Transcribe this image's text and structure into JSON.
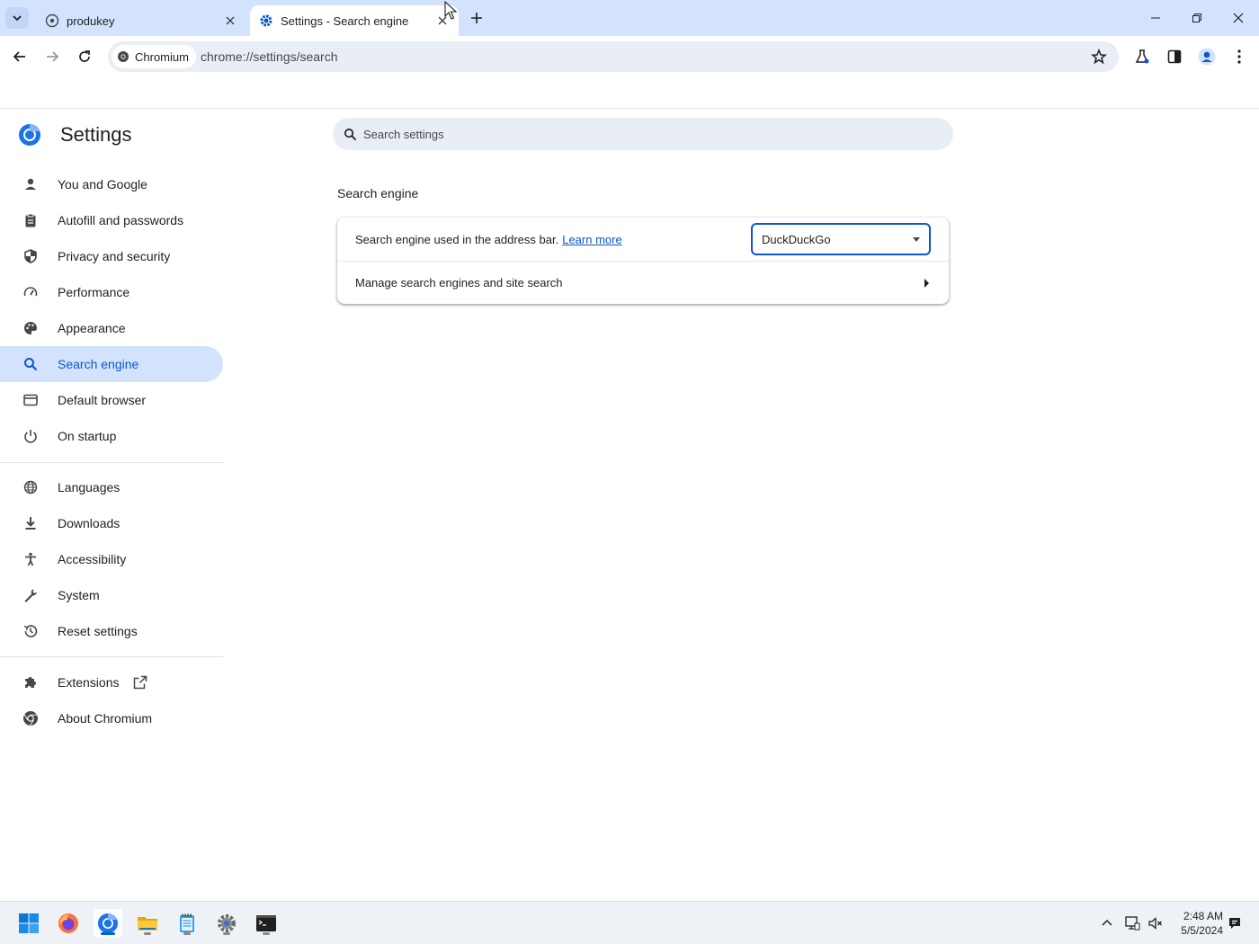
{
  "tabs": [
    {
      "title": "produkey",
      "active": false
    },
    {
      "title": "Settings - Search engine",
      "active": true
    }
  ],
  "toolbar": {
    "site_chip": "Chromium",
    "url": "chrome://settings/search"
  },
  "sidebar": {
    "title": "Settings",
    "items": [
      {
        "label": "You and Google",
        "icon": "person-icon"
      },
      {
        "label": "Autofill and passwords",
        "icon": "clipboard-icon"
      },
      {
        "label": "Privacy and security",
        "icon": "shield-icon"
      },
      {
        "label": "Performance",
        "icon": "speedometer-icon"
      },
      {
        "label": "Appearance",
        "icon": "palette-icon"
      },
      {
        "label": "Search engine",
        "icon": "search-icon",
        "selected": true
      },
      {
        "label": "Default browser",
        "icon": "browser-window-icon"
      },
      {
        "label": "On startup",
        "icon": "power-icon"
      },
      {
        "label": "Languages",
        "icon": "globe-icon"
      },
      {
        "label": "Downloads",
        "icon": "download-icon"
      },
      {
        "label": "Accessibility",
        "icon": "accessibility-icon"
      },
      {
        "label": "System",
        "icon": "wrench-icon"
      },
      {
        "label": "Reset settings",
        "icon": "history-icon"
      },
      {
        "label": "Extensions",
        "icon": "puzzle-icon"
      },
      {
        "label": "About Chromium",
        "icon": "chromium-icon"
      }
    ]
  },
  "main": {
    "search_placeholder": "Search settings",
    "section_title": "Search engine",
    "row1_label": "Search engine used in the address bar.",
    "learn_more": "Learn more",
    "engine_value": "DuckDuckGo",
    "row2_label": "Manage search engines and site search"
  },
  "taskbar": {
    "apps": [
      "windows-start",
      "firefox",
      "chromium",
      "file-explorer",
      "notepad",
      "settings",
      "terminal"
    ],
    "time": "2:48 AM",
    "date": "5/5/2024"
  },
  "colors": {
    "accent": "#0b57d0",
    "tabstrip": "#d3e3fd",
    "omnibox": "#e9eef6",
    "selected_nav": "#d3e3fd"
  }
}
